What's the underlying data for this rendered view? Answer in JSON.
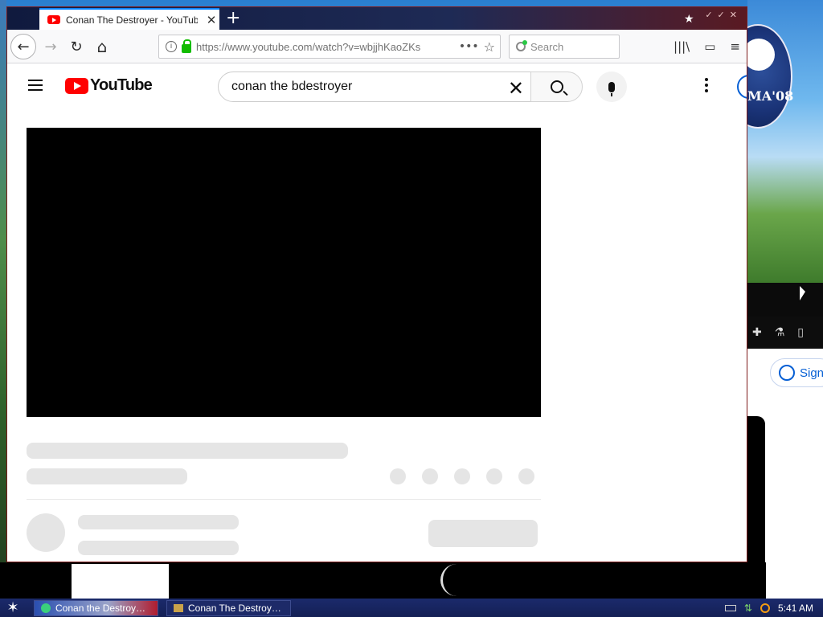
{
  "desktop": {
    "logo_text": "MA'08"
  },
  "browser": {
    "tab": {
      "title": "Conan The Destroyer - YouTube",
      "close": "✕"
    },
    "new_tab_label": "+",
    "url": "https://www.youtube.com/watch?v=wbjjhKaoZKs",
    "search_placeholder": "Search",
    "page_actions": "•••",
    "bookmark_star": "☆",
    "toolbar": {
      "back": "←",
      "forward": "→",
      "reload": "↻",
      "home": "⌂",
      "library": "|||\\",
      "sidebar": "▭",
      "menu": "≡"
    }
  },
  "youtube": {
    "logo_text": "YouTube",
    "search_query": "conan the bdestroyer",
    "clear_icon": "✕"
  },
  "background_window": {
    "signin_label": "Sign"
  },
  "taskbar": {
    "tasks": [
      {
        "label": "Conan the Destroy…",
        "active": true
      },
      {
        "label": "Conan The Destroy…",
        "active": false
      }
    ],
    "clock": "5:41 AM"
  },
  "colors": {
    "youtube_red": "#ff0000",
    "firefox_accent": "#0a84ff",
    "lock_green": "#12bc00",
    "load_bar": "#e9342c",
    "skeleton": "#e5e5e5"
  },
  "icons": {
    "tab_favicon": "youtube-favicon-icon",
    "nav": [
      "back-arrow-icon",
      "forward-arrow-icon",
      "reload-icon",
      "home-icon"
    ],
    "url": [
      "info-icon",
      "lock-icon",
      "more-dots-icon",
      "bookmark-star-icon"
    ],
    "yt": [
      "hamburger-menu-icon",
      "youtube-logo-icon",
      "clear-icon",
      "search-icon",
      "microphone-icon",
      "more-vertical-icon",
      "account-icon"
    ]
  }
}
